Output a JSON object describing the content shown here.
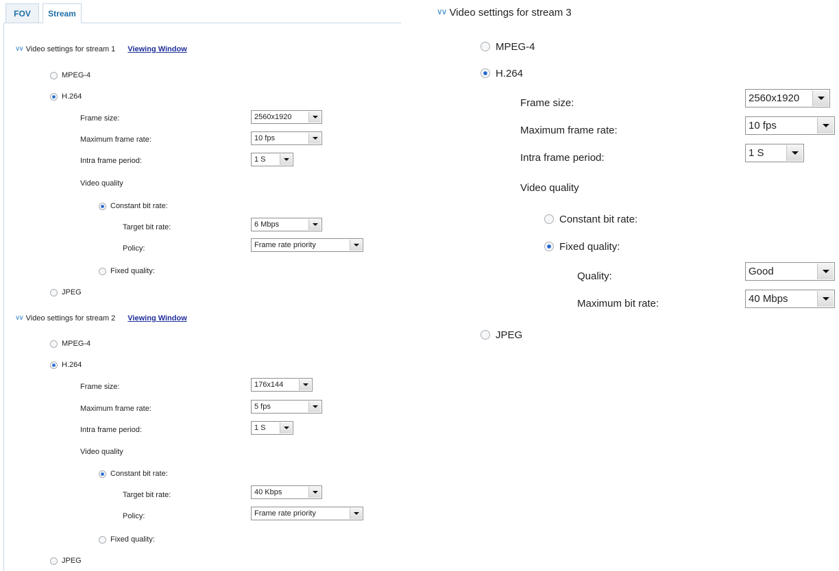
{
  "tabs": [
    "FOV",
    "Stream"
  ],
  "stream1": {
    "title": "Video settings for stream 1",
    "link": "Viewing Window",
    "codecs": {
      "mpeg4": "MPEG-4",
      "h264": "H.264",
      "jpeg": "JPEG"
    },
    "labels": {
      "frame_size": "Frame size:",
      "max_frame_rate": "Maximum frame rate:",
      "intra_frame_period": "Intra frame period:",
      "video_quality": "Video quality",
      "constant_bit_rate": "Constant bit rate:",
      "target_bit_rate": "Target bit rate:",
      "policy": "Policy:",
      "fixed_quality": "Fixed quality:"
    },
    "values": {
      "frame_size": "2560x1920",
      "max_frame_rate": "10 fps",
      "intra_frame_period": "1 S",
      "target_bit_rate": "6 Mbps",
      "policy": "Frame rate priority"
    },
    "selected_codec": "H.264",
    "selected_quality_mode": "Constant bit rate:"
  },
  "stream2": {
    "title": "Video settings for stream 2",
    "link": "Viewing Window",
    "codecs": {
      "mpeg4": "MPEG-4",
      "h264": "H.264",
      "jpeg": "JPEG"
    },
    "labels": {
      "frame_size": "Frame size:",
      "max_frame_rate": "Maximum frame rate:",
      "intra_frame_period": "Intra frame period:",
      "video_quality": "Video quality",
      "constant_bit_rate": "Constant bit rate:",
      "target_bit_rate": "Target bit rate:",
      "policy": "Policy:",
      "fixed_quality": "Fixed quality:"
    },
    "values": {
      "frame_size": "176x144",
      "max_frame_rate": "5 fps",
      "intra_frame_period": "1 S",
      "target_bit_rate": "40 Kbps",
      "policy": "Frame rate priority"
    },
    "selected_codec": "H.264",
    "selected_quality_mode": "Constant bit rate:"
  },
  "stream3": {
    "title": "Video settings for stream 3",
    "codecs": {
      "mpeg4": "MPEG-4",
      "h264": "H.264",
      "jpeg": "JPEG"
    },
    "labels": {
      "frame_size": "Frame size:",
      "max_frame_rate": "Maximum frame rate:",
      "intra_frame_period": "Intra frame period:",
      "video_quality": "Video quality",
      "constant_bit_rate": "Constant bit rate:",
      "fixed_quality": "Fixed quality:",
      "quality": "Quality:",
      "max_bit_rate": "Maximum bit rate:"
    },
    "values": {
      "frame_size": "2560x1920",
      "max_frame_rate": "10 fps",
      "intra_frame_period": "1 S",
      "quality": "Good",
      "max_bit_rate": "40 Mbps"
    },
    "selected_codec": "H.264",
    "selected_quality_mode": "Fixed quality:"
  },
  "colors": {
    "link": "#1f2e9a",
    "tab_text": "#1e6ea8",
    "chevron": "#3a8ad0",
    "radio_selected": "#1d5ec8",
    "border": "#c8d7e6"
  }
}
